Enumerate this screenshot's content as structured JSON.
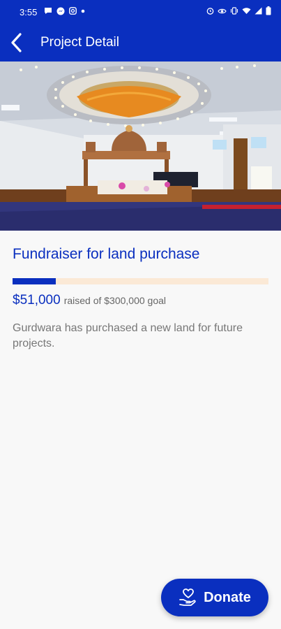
{
  "status_bar": {
    "time": "3:55",
    "left_icons": [
      "chat-bubble-icon",
      "messenger-icon",
      "instagram-icon",
      "dot-icon"
    ],
    "right_icons": [
      "alarm-icon",
      "eye-icon",
      "vibrate-icon",
      "wifi-icon",
      "signal-icon",
      "battery-icon"
    ]
  },
  "app_bar": {
    "title": "Project Detail",
    "back_icon": "chevron-left-icon"
  },
  "hero": {
    "image_subject": "gurdwara-interior-photo"
  },
  "project": {
    "title": "Fundraiser for land purchase",
    "raised_amount": "$51,000",
    "raised_text": "raised of $300,000 goal",
    "progress_fraction": 0.17,
    "description": "Gurdwara has purchased a new land for future projects."
  },
  "donate": {
    "label": "Donate",
    "icon": "heart-hand-icon"
  },
  "colors": {
    "primary": "#0a2fbf",
    "progress_track": "#fbe9d6",
    "background": "#f8f8f8"
  }
}
